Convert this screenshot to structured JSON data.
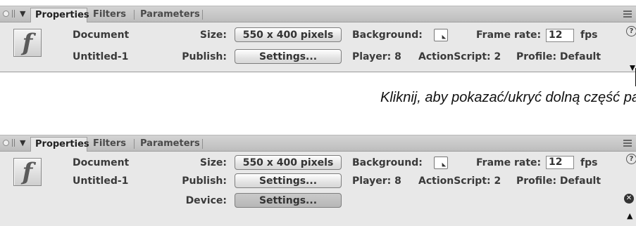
{
  "caption": "Kliknij, aby pokazać/ukryć dolną część panelu",
  "tabs": [
    "Properties",
    "Filters",
    "Parameters"
  ],
  "icon_glyph": "f",
  "panels": [
    {
      "doc_type": "Document",
      "doc_name": "Untitled-1",
      "size_label": "Size:",
      "size_value": "550 x 400 pixels",
      "publish_label": "Publish:",
      "publish_button": "Settings...",
      "background_label": "Background:",
      "background_color": "#ffffff",
      "frame_rate_label": "Frame rate:",
      "frame_rate_value": "12",
      "fps_label": "fps",
      "player": "Player: 8",
      "actionscript": "ActionScript: 2",
      "profile": "Profile: Default"
    },
    {
      "doc_type": "Document",
      "doc_name": "Untitled-1",
      "size_label": "Size:",
      "size_value": "550 x 400 pixels",
      "publish_label": "Publish:",
      "publish_button": "Settings...",
      "device_label": "Device:",
      "device_button": "Settings...",
      "background_label": "Background:",
      "background_color": "#ffffff",
      "frame_rate_label": "Frame rate:",
      "frame_rate_value": "12",
      "fps_label": "fps",
      "player": "Player: 8",
      "actionscript": "ActionScript: 2",
      "profile": "Profile: Default"
    }
  ],
  "icons": {
    "collapse": "triangle-down-icon",
    "options": "panel-options-icon",
    "help": "help-icon",
    "expand_toggle": "triangle-toggle-icon",
    "device": "device-settings-icon"
  }
}
